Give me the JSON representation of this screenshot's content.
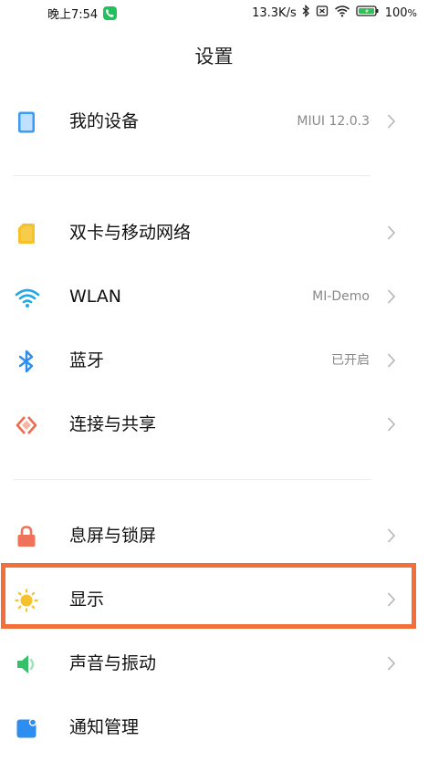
{
  "status_bar": {
    "time": "晚上7:54",
    "net_speed": "13.3K/s",
    "battery": "100",
    "battery_unit": "%"
  },
  "header": {
    "title": "设置"
  },
  "settings": {
    "my_device": {
      "label": "我的设备",
      "value": "MIUI 12.0.3",
      "icon": "phone-icon",
      "color": "#3d9cf0"
    },
    "sim": {
      "label": "双卡与移动网络",
      "icon": "sim-card-icon",
      "color": "#f6c12b"
    },
    "wlan": {
      "label": "WLAN",
      "value": "MI-Demo",
      "icon": "wifi-icon",
      "color": "#22a7e8"
    },
    "bluetooth": {
      "label": "蓝牙",
      "value": "已开启",
      "icon": "bluetooth-icon",
      "color": "#2e8df0"
    },
    "connection": {
      "label": "连接与共享",
      "icon": "share-icon",
      "color": "#f06a4e"
    },
    "lock": {
      "label": "息屏与锁屏",
      "icon": "lock-icon",
      "color": "#f0725a"
    },
    "display": {
      "label": "显示",
      "icon": "sun-icon",
      "color": "#f6c12b",
      "highlighted": true,
      "highlight_color": "#f26f3c"
    },
    "sound": {
      "label": "声音与振动",
      "icon": "speaker-icon",
      "color": "#35c06a"
    },
    "notification": {
      "label": "通知管理",
      "icon": "notification-icon",
      "color": "#2e8df0"
    }
  }
}
